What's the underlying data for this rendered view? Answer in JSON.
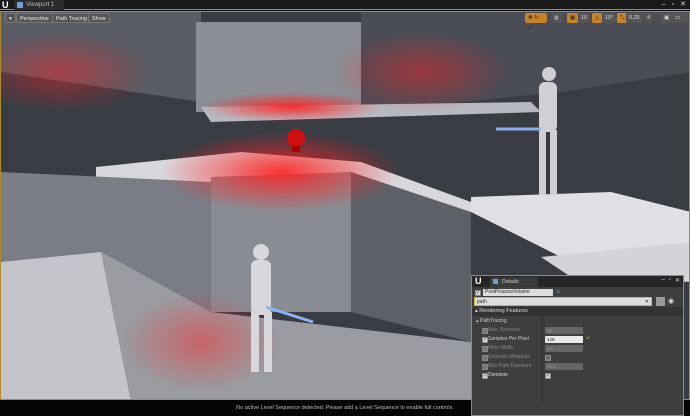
{
  "window": {
    "tab_label": "Viewport 1",
    "logo": "U"
  },
  "toolbar": {
    "menu": "▾",
    "perspective": "Perspective",
    "path_tracing": "Path Tracing",
    "show": "Show",
    "grid_snap": "10",
    "rot_snap": "10°",
    "scale_snap": "0.25",
    "camera_speed": "4"
  },
  "status": {
    "message": "No active Level Sequence detected. Please add a Level Sequence to enable full controls."
  },
  "details": {
    "tab_label": "Details",
    "actor_name": "PostProcessVolume",
    "search_value": "path",
    "section": "Rendering Features",
    "subsection": "PathTracing",
    "rows": [
      {
        "label": "Max. Bounces",
        "value": "32",
        "enabled": false,
        "checkbox": true
      },
      {
        "label": "Samples Per Pixel",
        "value": "128",
        "enabled": true,
        "checkbox": true
      },
      {
        "label": "Filter Width",
        "value": "3.0",
        "enabled": false,
        "checkbox": false
      },
      {
        "label": "Emissive Materials",
        "value": "",
        "enabled": false,
        "checkbox": false
      },
      {
        "label": "Max Path Exposure",
        "value": "30.0",
        "enabled": false,
        "checkbox": false
      },
      {
        "label": "Denoiser",
        "value": "",
        "enabled": true,
        "checkbox": true
      }
    ]
  },
  "colors": {
    "accent": "#b08a2a",
    "light_red": "#d01010"
  }
}
